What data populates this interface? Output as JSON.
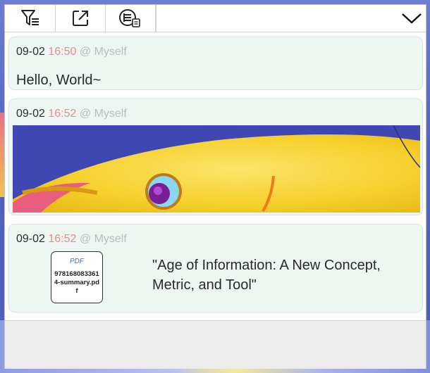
{
  "toolbar": {
    "buttons": [
      {
        "icon": "filter-list-icon"
      },
      {
        "icon": "open-external-icon"
      },
      {
        "icon": "log-list-icon"
      }
    ],
    "collapse_icon": "chevron-down-icon"
  },
  "messages": [
    {
      "type": "text",
      "date": "09-02",
      "time": "16:50",
      "user": "@ Myself",
      "text": "Hello, World~"
    },
    {
      "type": "image",
      "date": "09-02",
      "time": "16:52",
      "user": "@ Myself"
    },
    {
      "type": "file",
      "date": "09-02",
      "time": "16:52",
      "user": "@ Myself",
      "file_type": "PDF",
      "file_name": "9781680833614-summary.pdf",
      "title": "\"Age of Information: A New Concept, Metric, and Tool\""
    }
  ],
  "colors": {
    "card_bg": "#eef6f2",
    "time": "#ec8a8a",
    "user": "#b7bcc0"
  }
}
